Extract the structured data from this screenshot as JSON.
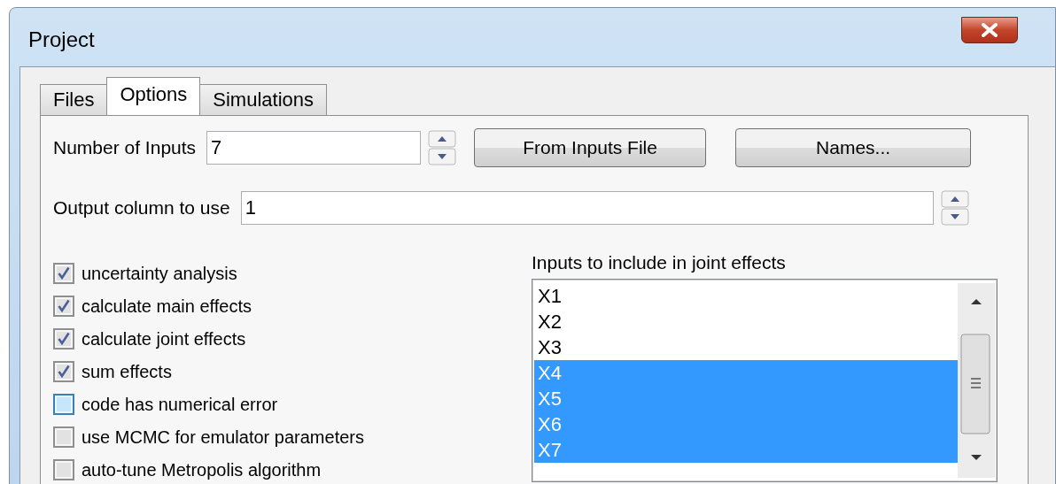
{
  "window": {
    "title": "Project"
  },
  "tabs": [
    {
      "label": "Files",
      "selected": false
    },
    {
      "label": "Options",
      "selected": true
    },
    {
      "label": "Simulations",
      "selected": false
    }
  ],
  "number_of_inputs": {
    "label": "Number of Inputs",
    "value": "7"
  },
  "buttons": [
    "From Inputs File",
    "Names..."
  ],
  "output_column": {
    "label": "Output column to use",
    "value": "1"
  },
  "options": [
    {
      "label": "uncertainty analysis",
      "checked": true,
      "hovered": false
    },
    {
      "label": "calculate main effects",
      "checked": true,
      "hovered": false
    },
    {
      "label": "calculate joint effects",
      "checked": true,
      "hovered": false
    },
    {
      "label": "sum effects",
      "checked": true,
      "hovered": false
    },
    {
      "label": "code has numerical error",
      "checked": false,
      "hovered": true
    },
    {
      "label": "use MCMC for emulator parameters",
      "checked": false,
      "hovered": false
    },
    {
      "label": "auto-tune Metropolis algorithm",
      "checked": false,
      "hovered": false
    }
  ],
  "joint_effects": {
    "label": "Inputs to include in joint effects",
    "items": [
      {
        "label": "X1",
        "selected": false
      },
      {
        "label": "X2",
        "selected": false
      },
      {
        "label": "X3",
        "selected": false
      },
      {
        "label": "X4",
        "selected": true
      },
      {
        "label": "X5",
        "selected": true
      },
      {
        "label": "X6",
        "selected": true
      },
      {
        "label": "X7",
        "selected": true
      }
    ]
  }
}
